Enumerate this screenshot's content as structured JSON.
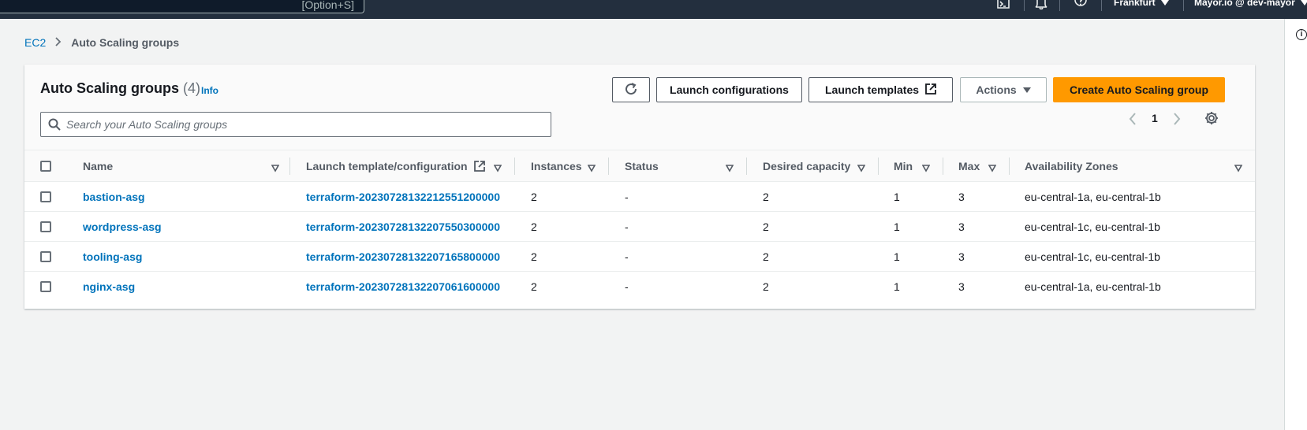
{
  "topnav": {
    "search_shortcut": "[Option+S]",
    "icons": [
      "cloudshell-icon",
      "bell-icon",
      "help-icon"
    ],
    "region": "Frankfurt",
    "account": "Mayor.io @ dev-mayor"
  },
  "breadcrumb": {
    "root": "EC2",
    "current": "Auto Scaling groups"
  },
  "panel": {
    "title": "Auto Scaling groups",
    "count": "(4)",
    "info": "Info",
    "buttons": {
      "launch_configurations": "Launch configurations",
      "launch_templates": "Launch templates",
      "actions": "Actions",
      "create": "Create Auto Scaling group"
    },
    "search_placeholder": "Search your Auto Scaling groups",
    "page": "1"
  },
  "table": {
    "columns": {
      "name": "Name",
      "launch": "Launch template/configuration",
      "instances": "Instances",
      "status": "Status",
      "desired": "Desired capacity",
      "min": "Min",
      "max": "Max",
      "azs": "Availability Zones"
    },
    "rows": [
      {
        "name": "bastion-asg",
        "launch": "terraform-20230728132212551200000",
        "instances": "2",
        "status": "-",
        "desired": "2",
        "min": "1",
        "max": "3",
        "azs": "eu-central-1a, eu-central-1b"
      },
      {
        "name": "wordpress-asg",
        "launch": "terraform-20230728132207550300000",
        "instances": "2",
        "status": "-",
        "desired": "2",
        "min": "1",
        "max": "3",
        "azs": "eu-central-1c, eu-central-1b"
      },
      {
        "name": "tooling-asg",
        "launch": "terraform-20230728132207165800000",
        "instances": "2",
        "status": "-",
        "desired": "2",
        "min": "1",
        "max": "3",
        "azs": "eu-central-1c, eu-central-1b"
      },
      {
        "name": "nginx-asg",
        "launch": "terraform-20230728132207061600000",
        "instances": "2",
        "status": "-",
        "desired": "2",
        "min": "1",
        "max": "3",
        "azs": "eu-central-1a, eu-central-1b"
      }
    ]
  },
  "colors": {
    "topnav_bg": "#232f3e",
    "link": "#0073bb",
    "primary_button": "#ff9900",
    "page_bg": "#f2f3f3"
  }
}
